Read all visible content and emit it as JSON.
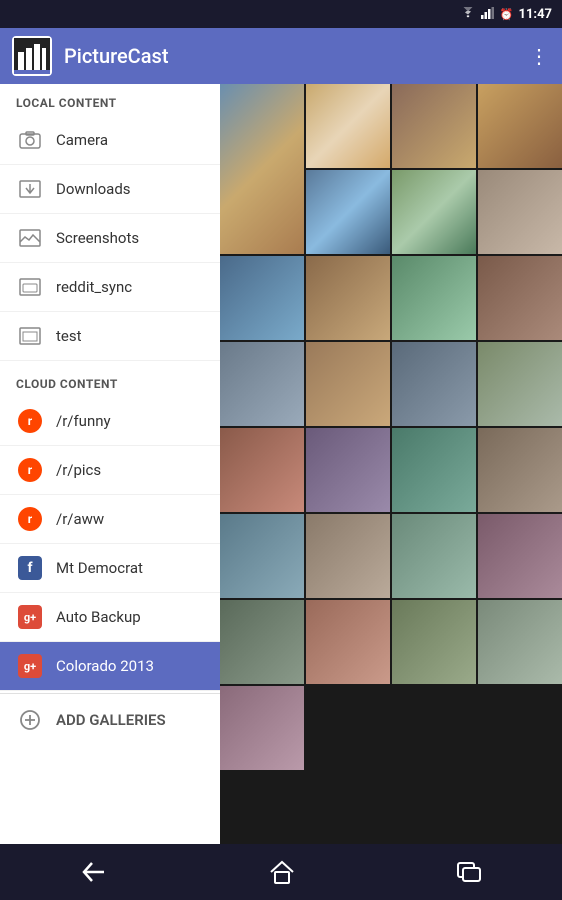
{
  "statusBar": {
    "time": "11:47",
    "wifiIcon": "wifi",
    "signalIcon": "signal",
    "alarmIcon": "alarm"
  },
  "appBar": {
    "title": "PictureCast",
    "menuIcon": "⋮",
    "logoIcon": "🏢"
  },
  "sidebar": {
    "localContentLabel": "LOCAL CONTENT",
    "cloudContentLabel": "CLOUD CONTENT",
    "localItems": [
      {
        "id": "camera",
        "label": "Camera",
        "icon": "image"
      },
      {
        "id": "downloads",
        "label": "Downloads",
        "icon": "image"
      },
      {
        "id": "screenshots",
        "label": "Screenshots",
        "icon": "image"
      },
      {
        "id": "reddit_sync",
        "label": "reddit_sync",
        "icon": "image"
      },
      {
        "id": "test",
        "label": "test",
        "icon": "image"
      }
    ],
    "cloudItems": [
      {
        "id": "r-funny",
        "label": "/r/funny",
        "icon": "reddit"
      },
      {
        "id": "r-pics",
        "label": "/r/pics",
        "icon": "reddit"
      },
      {
        "id": "r-aww",
        "label": "/r/aww",
        "icon": "reddit"
      },
      {
        "id": "mt-democrat",
        "label": "Mt Democrat",
        "icon": "facebook"
      },
      {
        "id": "auto-backup",
        "label": "Auto Backup",
        "icon": "gplus"
      },
      {
        "id": "colorado-2013",
        "label": "Colorado 2013",
        "icon": "gplus",
        "active": true
      }
    ],
    "addGalleriesLabel": "ADD GALLERIES"
  },
  "navBar": {
    "backLabel": "←",
    "homeLabel": "⌂",
    "recentLabel": "▭"
  },
  "photos": {
    "count": 28,
    "classes": [
      "p1",
      "p2",
      "p3",
      "p4",
      "p5",
      "p6",
      "p7",
      "p8",
      "p9",
      "p10",
      "p11",
      "p12",
      "p13",
      "p14",
      "p15",
      "p16",
      "p17",
      "p18",
      "p19",
      "p20",
      "p21",
      "p22",
      "p23",
      "p24",
      "p25",
      "p26",
      "p27",
      "p28"
    ]
  }
}
